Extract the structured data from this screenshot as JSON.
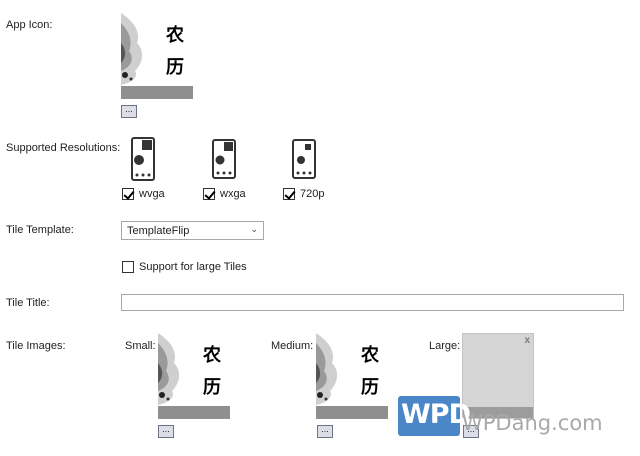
{
  "form": {
    "app_icon_label": "App Icon:",
    "supported_resolutions_label": "Supported Resolutions:",
    "tile_template_label": "Tile Template:",
    "tile_title_label": "Tile Title:",
    "tile_images_label": "Tile Images:"
  },
  "icon_glyphs": {
    "top": "农",
    "bottom": "历"
  },
  "browse_label": "...",
  "resolutions": [
    {
      "label": "wvga",
      "checked": true
    },
    {
      "label": "wxga",
      "checked": true
    },
    {
      "label": "720p",
      "checked": true
    }
  ],
  "tile_template": {
    "selected": "TemplateFlip"
  },
  "large_tiles": {
    "label": "Support for large Tiles",
    "checked": false
  },
  "tile_title": {
    "value": ""
  },
  "tile_images": {
    "small_label": "Small:",
    "medium_label": "Medium:",
    "large_label": "Large:",
    "close_glyph": "x"
  },
  "watermark": {
    "logo": "WPD",
    "text": "WPDang.com",
    "logo_color": "#4a86c8"
  }
}
